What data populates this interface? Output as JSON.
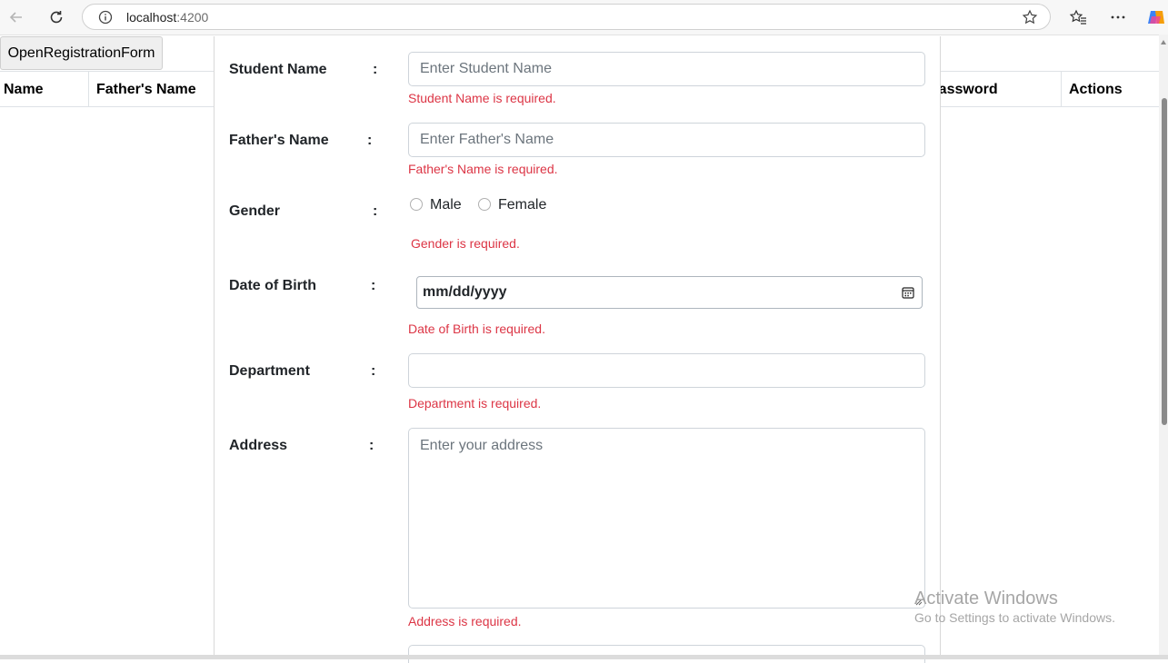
{
  "browser": {
    "url_host": "localhost",
    "url_port": ":4200"
  },
  "page": {
    "open_button_label": "OpenRegistrationForm",
    "table_headers": [
      "Name",
      "Father's Name",
      "Password",
      "Actions"
    ]
  },
  "form": {
    "student_name": {
      "label": "Student Name",
      "colon": ":",
      "placeholder": "Enter Student Name",
      "error": "Student Name is required."
    },
    "father_name": {
      "label": "Father's Name",
      "colon": ":",
      "placeholder": "Enter Father's Name",
      "error": "Father's Name is required."
    },
    "gender": {
      "label": "Gender",
      "colon": ":",
      "options": [
        "Male",
        "Female"
      ],
      "error": "Gender is required."
    },
    "dob": {
      "label": "Date of Birth",
      "colon": ":",
      "value": "mm/dd/yyyy",
      "error": "Date of Birth is required."
    },
    "department": {
      "label": "Department",
      "colon": ":",
      "value": "",
      "error": "Department is required."
    },
    "address": {
      "label": "Address",
      "colon": ":",
      "placeholder": "Enter your address",
      "error": "Address is required."
    }
  },
  "watermark": {
    "title": "Activate Windows",
    "subtitle": "Go to Settings to activate Windows."
  },
  "colors": {
    "error": "#dc3545",
    "input_border": "#ced4da",
    "label": "#212529"
  }
}
